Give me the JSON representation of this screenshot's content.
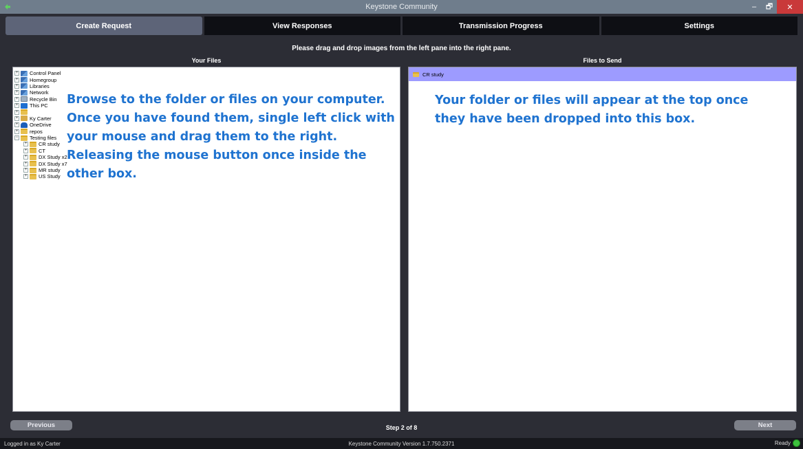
{
  "window": {
    "title": "Keystone Community",
    "minimize": "–",
    "maximize": "🗗",
    "close": "✕"
  },
  "tabs": [
    {
      "label": "Create Request",
      "active": true
    },
    {
      "label": "View Responses",
      "active": false
    },
    {
      "label": "Transmission Progress",
      "active": false
    },
    {
      "label": "Settings",
      "active": false
    }
  ],
  "instructions": "Please drag and drop images from the left pane into the right pane.",
  "left_pane": {
    "label": "Your Files",
    "tree": [
      {
        "label": "Control Panel",
        "icon": "control-panel-icon"
      },
      {
        "label": "Homegroup",
        "icon": "homegroup-icon"
      },
      {
        "label": "Libraries",
        "icon": "libraries-icon"
      },
      {
        "label": "Network",
        "icon": "network-icon"
      },
      {
        "label": "Recycle Bin",
        "icon": "recycle-bin-icon"
      },
      {
        "label": "This PC",
        "icon": "computer-icon"
      },
      {
        "label": "",
        "icon": "folder-icon"
      },
      {
        "label": "Ky Carter",
        "icon": "user-folder-icon"
      },
      {
        "label": "OneDrive",
        "icon": "onedrive-icon"
      },
      {
        "label": "repos",
        "icon": "folder-icon"
      },
      {
        "label": "Testing files",
        "icon": "folder-icon",
        "expanded": true
      },
      {
        "label": "CR study",
        "icon": "folder-icon",
        "child": true
      },
      {
        "label": "CT",
        "icon": "folder-icon",
        "child": true
      },
      {
        "label": "DX Study x2",
        "icon": "folder-icon",
        "child": true
      },
      {
        "label": "DX Study x7",
        "icon": "folder-icon",
        "child": true
      },
      {
        "label": "MR study",
        "icon": "folder-icon",
        "child": true
      },
      {
        "label": "US Study",
        "icon": "folder-icon",
        "child": true
      }
    ],
    "overlay_lines": [
      "Browse to the folder or files on your computer.",
      "Once you have found them, single left click with",
      "your mouse and drag them to the right.",
      "Releasing the mouse button once inside the",
      "other box."
    ]
  },
  "right_pane": {
    "label": "Files to Send",
    "items": [
      {
        "label": "CR study",
        "icon": "folder-icon"
      }
    ],
    "overlay_lines": [
      "Your folder or files will appear at the top once",
      "they have been dropped into this box."
    ]
  },
  "nav": {
    "previous": "Previous",
    "next": "Next",
    "step": "Step 2 of 8"
  },
  "status": {
    "logged_in": "Logged in as Ky Carter",
    "version": "Keystone Community Version 1.7.750.2371",
    "ready": "Ready"
  },
  "colors": {
    "accent_blue": "#1f73d0",
    "selection": "#9d9bff",
    "ready_green": "#3ec13e",
    "close_red": "#c9393a"
  }
}
